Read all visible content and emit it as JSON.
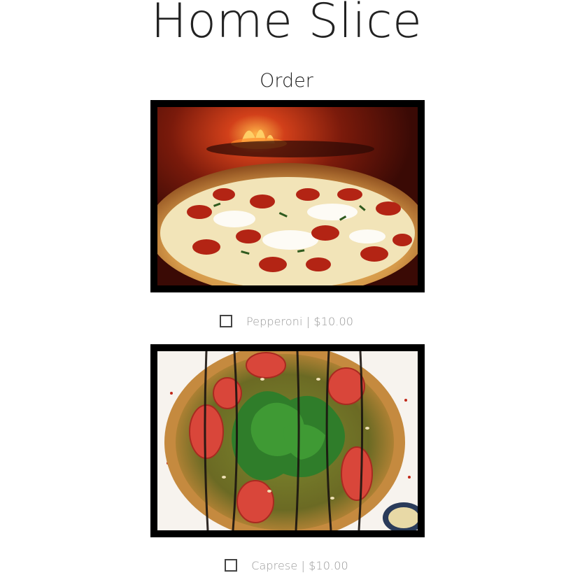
{
  "header": {
    "title": "Home Slice"
  },
  "main": {
    "section_title": "Order",
    "menu_items": [
      {
        "image_icon": "pepperoni-pizza-photo",
        "checked": false,
        "label": "Pepperoni | $10.00"
      },
      {
        "image_icon": "caprese-pizza-photo",
        "checked": false,
        "label": "Caprese | $10.00"
      }
    ]
  },
  "colors": {
    "frame": "#000000",
    "title_text": "#222222",
    "label_text": "#9a9a9a"
  }
}
